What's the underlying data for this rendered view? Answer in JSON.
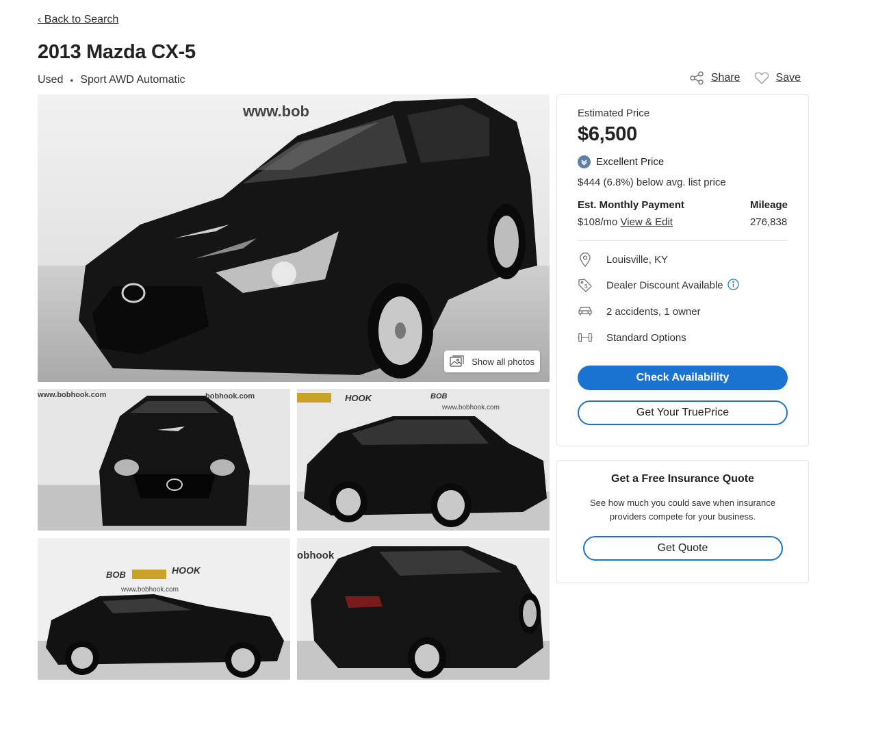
{
  "nav": {
    "back_label": "‹ Back to Search"
  },
  "listing": {
    "title": "2013 Mazda CX-5",
    "condition": "Used",
    "separator": "•",
    "trim": "Sport AWD Automatic"
  },
  "actions": {
    "share_label": "Share",
    "save_label": "Save"
  },
  "photos": {
    "show_all_label": "Show all photos",
    "watermarks": [
      "www.bob",
      "www.bobhook.com",
      "bobhook.com",
      "HOOK",
      "BOB",
      "www.bobhook.com",
      "BOB",
      "HOOK",
      "www.bobhook.com",
      "obhook"
    ]
  },
  "price_card": {
    "estimated_label": "Estimated Price",
    "price": "$6,500",
    "rating": "Excellent Price",
    "below_text": "$444 (6.8%) below avg. list price",
    "monthly_label": "Est. Monthly Payment",
    "monthly_value": "$108/mo",
    "view_edit_label": "View & Edit",
    "mileage_label": "Mileage",
    "mileage_value": "276,838",
    "features": [
      {
        "icon": "location-pin-icon",
        "text": "Louisville, KY"
      },
      {
        "icon": "price-tag-icon",
        "text": "Dealer Discount Available"
      },
      {
        "icon": "car-icon",
        "text": "2 accidents, 1 owner"
      },
      {
        "icon": "options-icon",
        "text": "Standard Options"
      }
    ],
    "check_label": "Check Availability",
    "trueprice_label": "Get Your TruePrice"
  },
  "insurance": {
    "title": "Get a Free Insurance Quote",
    "description": "See how much you could save when insurance providers compete for your business.",
    "button_label": "Get Quote"
  },
  "colors": {
    "primary": "#1a73d1",
    "rating_badge": "#5b7fa6",
    "car_body": "#151515"
  }
}
